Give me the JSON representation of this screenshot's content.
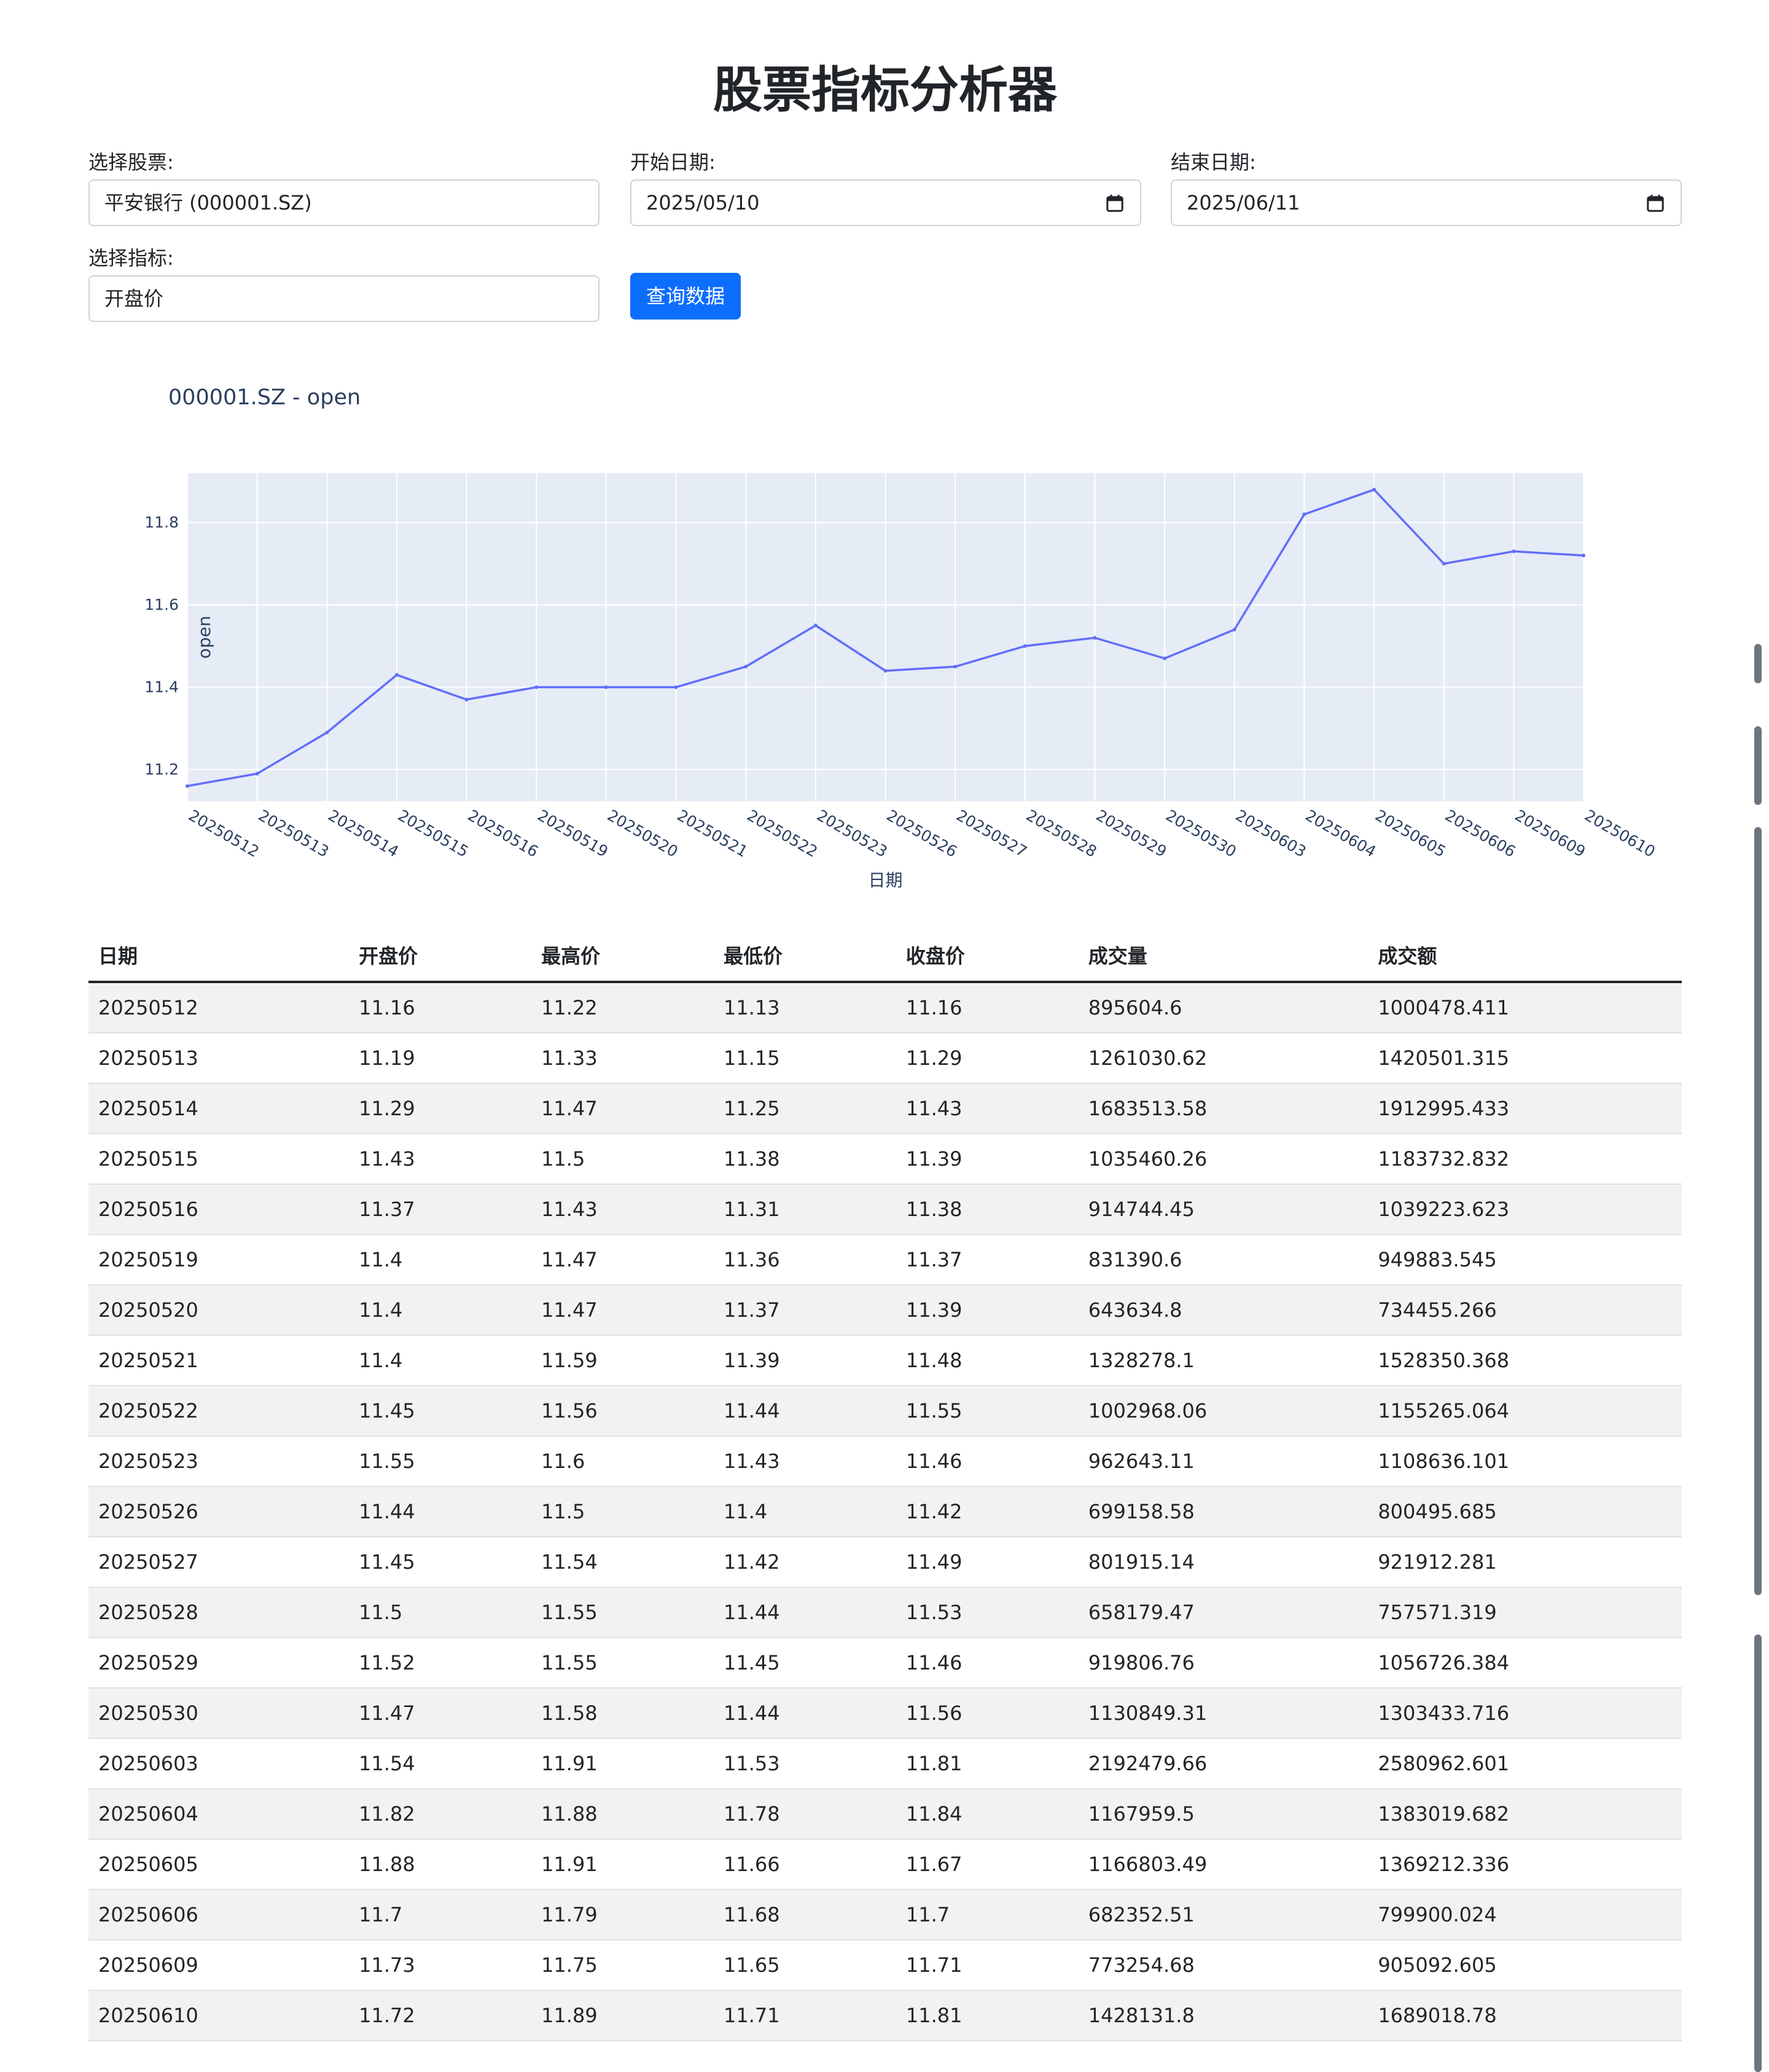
{
  "title": "股票指标分析器",
  "form": {
    "stock_label": "选择股票:",
    "stock_value": "平安银行 (000001.SZ)",
    "start_label": "开始日期:",
    "start_value": "2025/05/10",
    "end_label": "结束日期:",
    "end_value": "2025/06/11",
    "indicator_label": "选择指标:",
    "indicator_value": "开盘价",
    "query_button": "查询数据"
  },
  "chart_data": {
    "type": "line",
    "title": "000001.SZ - open",
    "xlabel": "日期",
    "ylabel": "open",
    "categories": [
      "20250512",
      "20250513",
      "20250514",
      "20250515",
      "20250516",
      "20250519",
      "20250520",
      "20250521",
      "20250522",
      "20250523",
      "20250526",
      "20250527",
      "20250528",
      "20250529",
      "20250530",
      "20250603",
      "20250604",
      "20250605",
      "20250606",
      "20250609",
      "20250610"
    ],
    "values": [
      11.16,
      11.19,
      11.29,
      11.43,
      11.37,
      11.4,
      11.4,
      11.4,
      11.45,
      11.55,
      11.44,
      11.45,
      11.5,
      11.52,
      11.47,
      11.54,
      11.82,
      11.88,
      11.7,
      11.73,
      11.72
    ],
    "yticks": [
      11.2,
      11.4,
      11.6,
      11.8
    ],
    "ylim": [
      11.123,
      11.92
    ],
    "grid": true,
    "colors": {
      "line": "#636efa",
      "plot_bg": "#e5ecf6",
      "grid": "#ffffff",
      "text": "#2a3f5f"
    }
  },
  "table": {
    "headers": [
      "日期",
      "开盘价",
      "最高价",
      "最低价",
      "收盘价",
      "成交量",
      "成交额"
    ],
    "rows": [
      [
        "20250512",
        "11.16",
        "11.22",
        "11.13",
        "11.16",
        "895604.6",
        "1000478.411"
      ],
      [
        "20250513",
        "11.19",
        "11.33",
        "11.15",
        "11.29",
        "1261030.62",
        "1420501.315"
      ],
      [
        "20250514",
        "11.29",
        "11.47",
        "11.25",
        "11.43",
        "1683513.58",
        "1912995.433"
      ],
      [
        "20250515",
        "11.43",
        "11.5",
        "11.38",
        "11.39",
        "1035460.26",
        "1183732.832"
      ],
      [
        "20250516",
        "11.37",
        "11.43",
        "11.31",
        "11.38",
        "914744.45",
        "1039223.623"
      ],
      [
        "20250519",
        "11.4",
        "11.47",
        "11.36",
        "11.37",
        "831390.6",
        "949883.545"
      ],
      [
        "20250520",
        "11.4",
        "11.47",
        "11.37",
        "11.39",
        "643634.8",
        "734455.266"
      ],
      [
        "20250521",
        "11.4",
        "11.59",
        "11.39",
        "11.48",
        "1328278.1",
        "1528350.368"
      ],
      [
        "20250522",
        "11.45",
        "11.56",
        "11.44",
        "11.55",
        "1002968.06",
        "1155265.064"
      ],
      [
        "20250523",
        "11.55",
        "11.6",
        "11.43",
        "11.46",
        "962643.11",
        "1108636.101"
      ],
      [
        "20250526",
        "11.44",
        "11.5",
        "11.4",
        "11.42",
        "699158.58",
        "800495.685"
      ],
      [
        "20250527",
        "11.45",
        "11.54",
        "11.42",
        "11.49",
        "801915.14",
        "921912.281"
      ],
      [
        "20250528",
        "11.5",
        "11.55",
        "11.44",
        "11.53",
        "658179.47",
        "757571.319"
      ],
      [
        "20250529",
        "11.52",
        "11.55",
        "11.45",
        "11.46",
        "919806.76",
        "1056726.384"
      ],
      [
        "20250530",
        "11.47",
        "11.58",
        "11.44",
        "11.56",
        "1130849.31",
        "1303433.716"
      ],
      [
        "20250603",
        "11.54",
        "11.91",
        "11.53",
        "11.81",
        "2192479.66",
        "2580962.601"
      ],
      [
        "20250604",
        "11.82",
        "11.88",
        "11.78",
        "11.84",
        "1167959.5",
        "1383019.682"
      ],
      [
        "20250605",
        "11.88",
        "11.91",
        "11.66",
        "11.67",
        "1166803.49",
        "1369212.336"
      ],
      [
        "20250606",
        "11.7",
        "11.79",
        "11.68",
        "11.7",
        "682352.51",
        "799900.024"
      ],
      [
        "20250609",
        "11.73",
        "11.75",
        "11.65",
        "11.71",
        "773254.68",
        "905092.605"
      ],
      [
        "20250610",
        "11.72",
        "11.89",
        "11.71",
        "11.81",
        "1428131.8",
        "1689018.78"
      ]
    ]
  }
}
